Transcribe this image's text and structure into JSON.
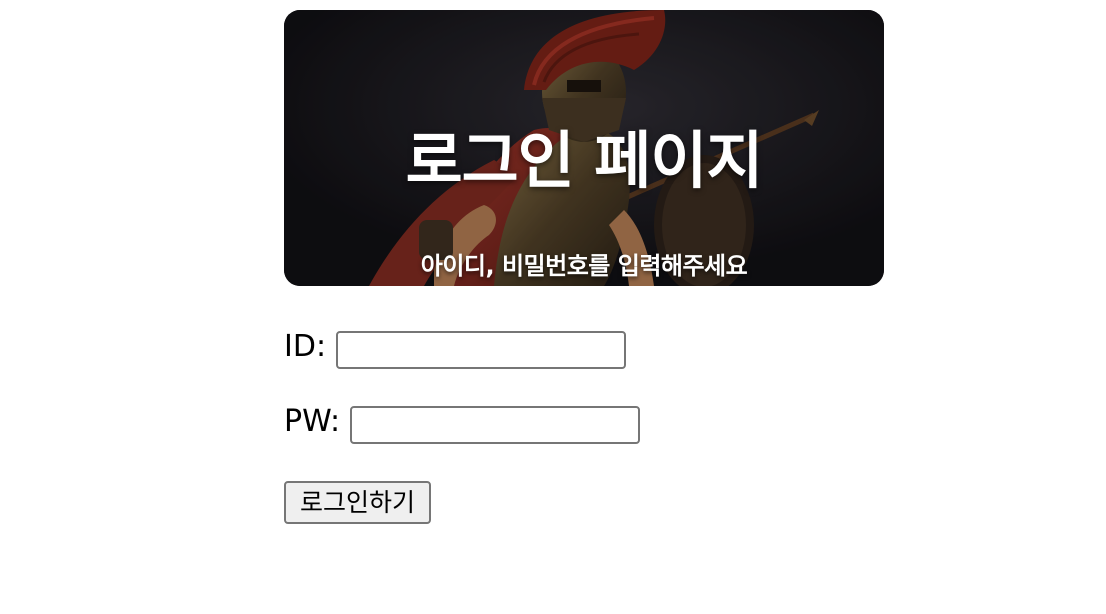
{
  "hero": {
    "title": "로그인 페이지",
    "subtitle": "아이디, 비밀번호를 입력해주세요",
    "image": "spartan-warrior-figure"
  },
  "form": {
    "id_label": "ID:",
    "id_value": "",
    "pw_label": "PW:",
    "pw_value": "",
    "submit_label": "로그인하기"
  },
  "colors": {
    "hero_background": "#16151a",
    "input_border": "#767676",
    "button_background": "#efefef"
  }
}
